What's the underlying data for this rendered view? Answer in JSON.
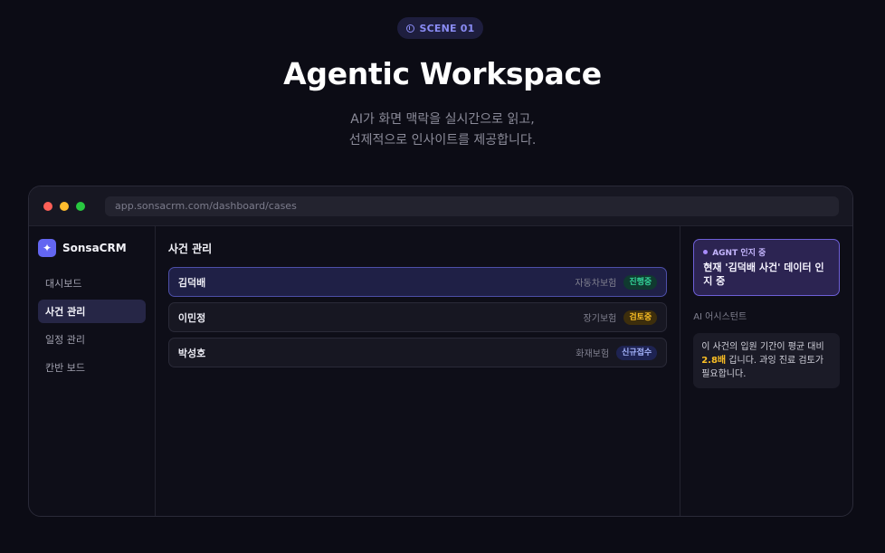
{
  "hero": {
    "scene_label": "SCENE 01",
    "title": "Agentic Workspace",
    "subtitle_line1": "AI가 화면 맥락을 실시간으로 읽고,",
    "subtitle_line2": "선제적으로 인사이트를 제공합니다."
  },
  "browser": {
    "url": "app.sonsacrm.com/dashboard/cases"
  },
  "sidebar": {
    "brand": "SonsaCRM",
    "logo_icon": "sparkle-icon",
    "items": [
      {
        "label": "대시보드",
        "active": false
      },
      {
        "label": "사건 관리",
        "active": true
      },
      {
        "label": "일정 관리",
        "active": false
      },
      {
        "label": "칸반 보드",
        "active": false
      }
    ]
  },
  "main": {
    "title": "사건 관리",
    "cases": [
      {
        "name": "김덕배",
        "type": "자동차보험",
        "status": "진행중",
        "status_color": "green",
        "selected": true
      },
      {
        "name": "이민정",
        "type": "장기보험",
        "status": "검토중",
        "status_color": "amber",
        "selected": false
      },
      {
        "name": "박성호",
        "type": "화재보험",
        "status": "신규접수",
        "status_color": "blue",
        "selected": false
      }
    ]
  },
  "panel": {
    "agent_status": "AGNT 인지 중",
    "agent_message": "현재 '김덕배 사건' 데이터 인지 중",
    "assistant_label": "AI 어시스턴트",
    "assistant_pre": "이 사건의 입원 기간이 평균 대비 ",
    "assistant_highlight": "2.8배",
    "assistant_post": " 깁니다. 과잉 진료 검토가 필요합니다."
  },
  "colors": {
    "background": "#0c0c15",
    "accent": "#6366f1",
    "agent_border": "#6d5fd6",
    "highlight": "#fbbf24"
  }
}
